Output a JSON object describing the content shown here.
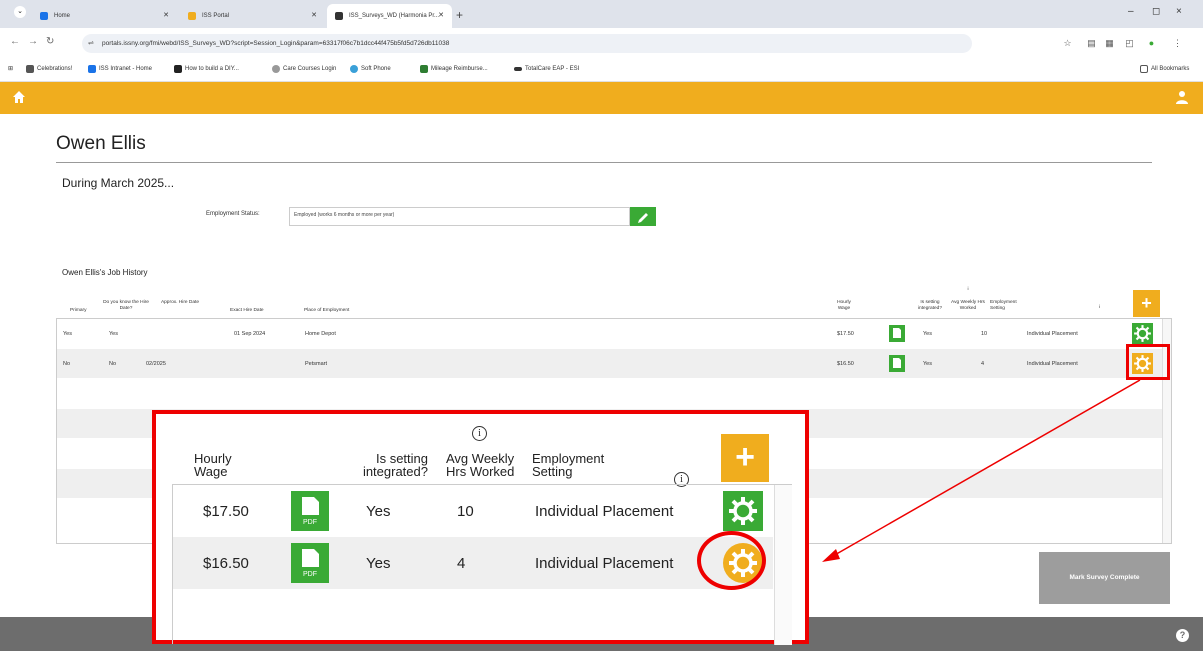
{
  "browser": {
    "tabs": [
      {
        "label": "Home",
        "color": "#1a73e8"
      },
      {
        "label": "ISS Portal",
        "color": "#f0ad1e"
      },
      {
        "label": "ISS_Surveys_WD (Harmonia Pr...",
        "color": "#333333"
      }
    ],
    "new_tab": "+",
    "win_controls": [
      "–",
      "◻",
      "×"
    ],
    "url": "portals.issny.org/fmi/webd/ISS_Surveys_WD?script=Session_Login&param=63317f06c7b1dcc44f475b5fd5d726db11038",
    "bookmarks": [
      {
        "label": "Celebrations!",
        "color": "#555555"
      },
      {
        "label": "ISS Intranet - Home",
        "color": "#1a73e8"
      },
      {
        "label": "How to build a DIY...",
        "color": "#222222"
      },
      {
        "label": "Care Courses Login",
        "color": "#999999"
      },
      {
        "label": "Soft Phone",
        "color": "#3aa0d8"
      },
      {
        "label": "Mileage Reimburse...",
        "color": "#2e7d32"
      },
      {
        "label": "TotalCare EAP - ESI",
        "color": "#333333"
      }
    ],
    "all_bookmarks": "All Bookmarks"
  },
  "colors": {
    "accent": "#f0ad1e",
    "green": "#3aaa35",
    "highlight": "#ee0000"
  },
  "page": {
    "person_name": "Owen Ellis",
    "during": "During March 2025...",
    "employment_status_label": "Employment Status:",
    "employment_status_value": "Employed (works 6 months or more per year)",
    "job_history_title": "Owen Ellis's Job History"
  },
  "table": {
    "headers": {
      "primary": "Primary",
      "know_hire_date": "Do you know the Hire Date?",
      "approx_hire_date": "Approx. Hire Date",
      "exact_hire_date": "Exact Hire Date",
      "place": "Place of Employment",
      "hourly_wage": "Hourly Wage",
      "setting_integrated": "Is setting integrated?",
      "avg_weekly_hrs": "Avg Weekly Hrs Worked",
      "employment_setting": "Employment Setting"
    },
    "rows": [
      {
        "primary": "Yes",
        "know_hire": "Yes",
        "approx": "",
        "exact": "01 Sep 2024",
        "place": "Home Depot",
        "wage": "$17.50",
        "integrated": "Yes",
        "hours": "10",
        "setting": "Individual Placement"
      },
      {
        "primary": "No",
        "know_hire": "No",
        "approx": "02/2025",
        "exact": "",
        "place": "Petsmart",
        "wage": "$16.50",
        "integrated": "Yes",
        "hours": "4",
        "setting": "Individual Placement"
      }
    ]
  },
  "zoom": {
    "hourly_wage": "Hourly Wage",
    "setting_integrated": "Is setting integrated?",
    "avg_weekly_hrs": "Avg Weekly Hrs Worked",
    "employment_setting": "Employment Setting",
    "rows": [
      {
        "wage": "$17.50",
        "integrated": "Yes",
        "hours": "10",
        "setting": "Individual Placement"
      },
      {
        "wage": "$16.50",
        "integrated": "Yes",
        "hours": "4",
        "setting": "Individual Placement"
      }
    ]
  },
  "actions": {
    "mark_complete": "Mark Survey Complete",
    "add_symbol": "+",
    "info_symbol": "i",
    "help_symbol": "?"
  }
}
